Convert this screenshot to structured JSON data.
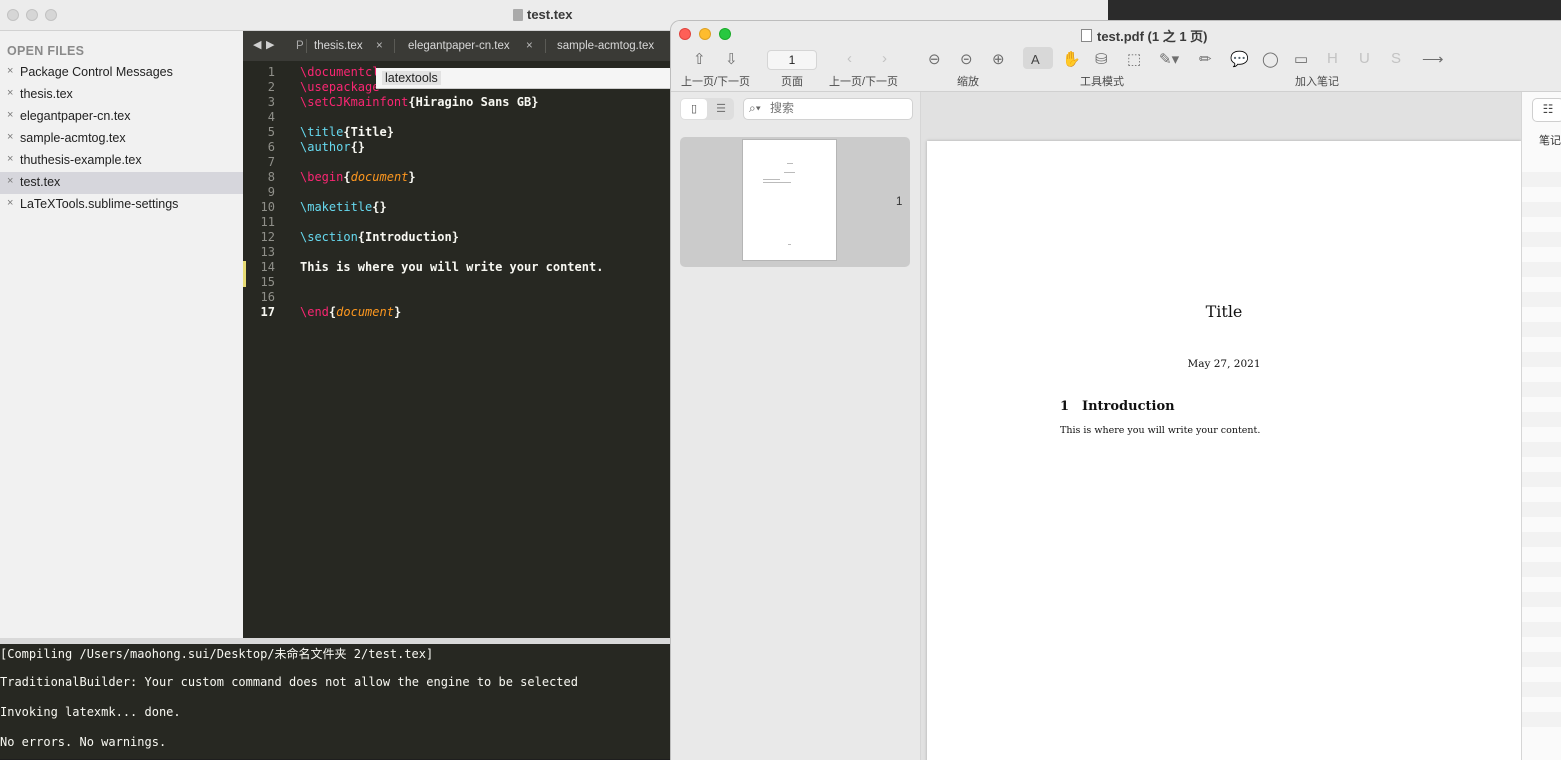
{
  "sublime": {
    "window_title": "test.tex",
    "sidebar": {
      "title": "OPEN FILES",
      "close_glyph": "×",
      "files": [
        {
          "name": "Package Control Messages",
          "active": false
        },
        {
          "name": "thesis.tex",
          "active": false
        },
        {
          "name": "elegantpaper-cn.tex",
          "active": false
        },
        {
          "name": "sample-acmtog.tex",
          "active": false
        },
        {
          "name": "thuthesis-example.tex",
          "active": false
        },
        {
          "name": "test.tex",
          "active": true
        },
        {
          "name": "LaTeXTools.sublime-settings",
          "active": false
        }
      ]
    },
    "tabs": {
      "partial": "P",
      "items": [
        "thesis.tex",
        "elegantpaper-cn.tex",
        "sample-acmtog.tex"
      ],
      "close_glyph": "×"
    },
    "autocomplete_text": "latextools",
    "editor": {
      "current_line": "17",
      "line_numbers": [
        "1",
        "2",
        "3",
        "4",
        "5",
        "6",
        "7",
        "8",
        "9",
        "10",
        "11",
        "12",
        "13",
        "14",
        "15",
        "16",
        "17"
      ],
      "lines": {
        "l1": "\\documentcl",
        "l2": "\\usepackage",
        "l3_cmd": "\\setCJKmainfont",
        "l3_arg": "{Hiragino Sans GB}",
        "l5_cmd": "\\title",
        "l5_arg": "{Title}",
        "l6_cmd": "\\author",
        "l6_arg": "{}",
        "l8_cmd": "\\begin",
        "l8_arg": "document",
        "l10_cmd": "\\maketitle",
        "l10_arg": "{}",
        "l12_cmd": "\\section",
        "l12_arg": "{Introduction}",
        "l14": "This is where you will write your content.",
        "l17_cmd": "\\end",
        "l17_arg": "document"
      }
    },
    "console": [
      "[Compiling /Users/maohong.sui/Desktop/未命名文件夹 2/test.tex]",
      "TraditionalBuilder: Your custom command does not allow the engine to be selected",
      "Invoking latexmk... done.",
      "No errors. No warnings."
    ]
  },
  "preview": {
    "window_title": "test.pdf (1 之 1 页)",
    "toolbar": {
      "page_value": "1",
      "labels": {
        "updown": "上一页/下一页",
        "page": "页面",
        "prevnext": "上一页/下一页",
        "zoom": "缩放",
        "tool_mode": "工具模式",
        "annotate": "加入笔记"
      },
      "icons": [
        "page-up-icon",
        "page-down-icon",
        "back-icon",
        "forward-icon",
        "zoom-fit-icon",
        "zoom-out-icon",
        "zoom-in-icon",
        "text-select-icon",
        "hand-icon",
        "stamp-icon",
        "rect-select-icon",
        "highlighter-icon",
        "pen-icon",
        "speech-bubble-icon",
        "circle-icon",
        "rectangle-icon",
        "highlight-h-icon",
        "underline-icon",
        "strikethrough-icon",
        "arrow-icon"
      ]
    },
    "sidebar": {
      "search_placeholder": "搜索",
      "thumbnail_number": "1"
    },
    "page": {
      "title": "Title",
      "date": "May 27, 2021",
      "section_number": "1",
      "section_title": "Introduction",
      "body": "This is where you will write your content."
    },
    "right_panel": {
      "label": "笔记"
    }
  }
}
